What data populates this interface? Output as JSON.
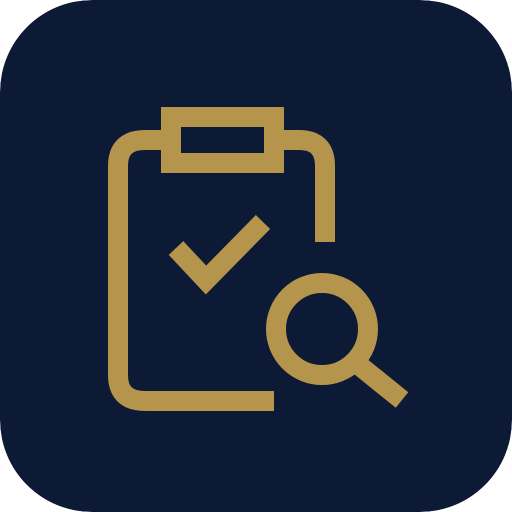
{
  "app_icon": {
    "icon_name": "clipboard-check-search-icon",
    "colors": {
      "background": "#0c1a36",
      "accent": "#b5944c"
    }
  }
}
